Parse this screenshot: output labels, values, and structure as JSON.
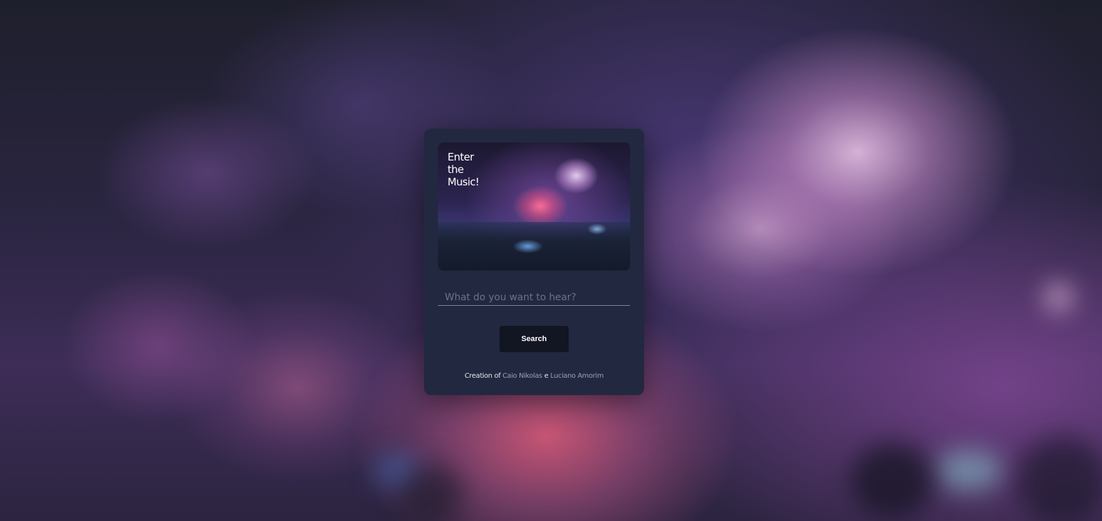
{
  "hero": {
    "title": "Enter\nthe\nMusic!"
  },
  "search": {
    "placeholder": "What do you want to hear?",
    "value": "",
    "button_label": "Search"
  },
  "footer": {
    "prefix": "Creation of",
    "author1": "Caio Nikolas",
    "separator": "e",
    "author2": "Luciano Amorim"
  },
  "colors": {
    "card_background": "#222840",
    "button_background": "#121522",
    "author_link": "#9aa0b4"
  }
}
